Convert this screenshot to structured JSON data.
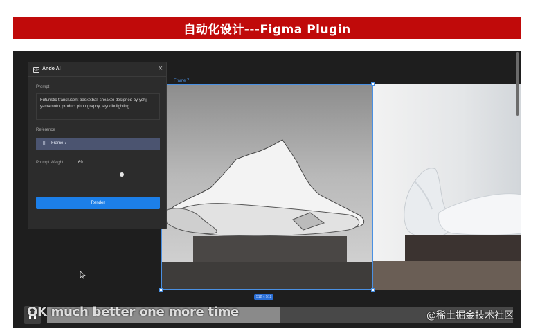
{
  "slide": {
    "title": "自动化设计---Figma Plugin"
  },
  "canvas": {
    "frame_label": "Frame 7",
    "dimensions": "512 × 512"
  },
  "plugin": {
    "title": "Ando AI",
    "prompt_label": "Prompt",
    "prompt_text": "Futuristic translucent basketball sneaker designed by yohji yamamoto, product photography, styudio lighting",
    "reference_label": "Reference",
    "reference_value": "Frame 7",
    "weight_label": "Prompt Weight",
    "weight_value": "69",
    "render_label": "Render"
  },
  "video": {
    "subtitle": "OK much better one more time",
    "watermark": "@稀土掘金技术社区",
    "progress": 0.5
  }
}
